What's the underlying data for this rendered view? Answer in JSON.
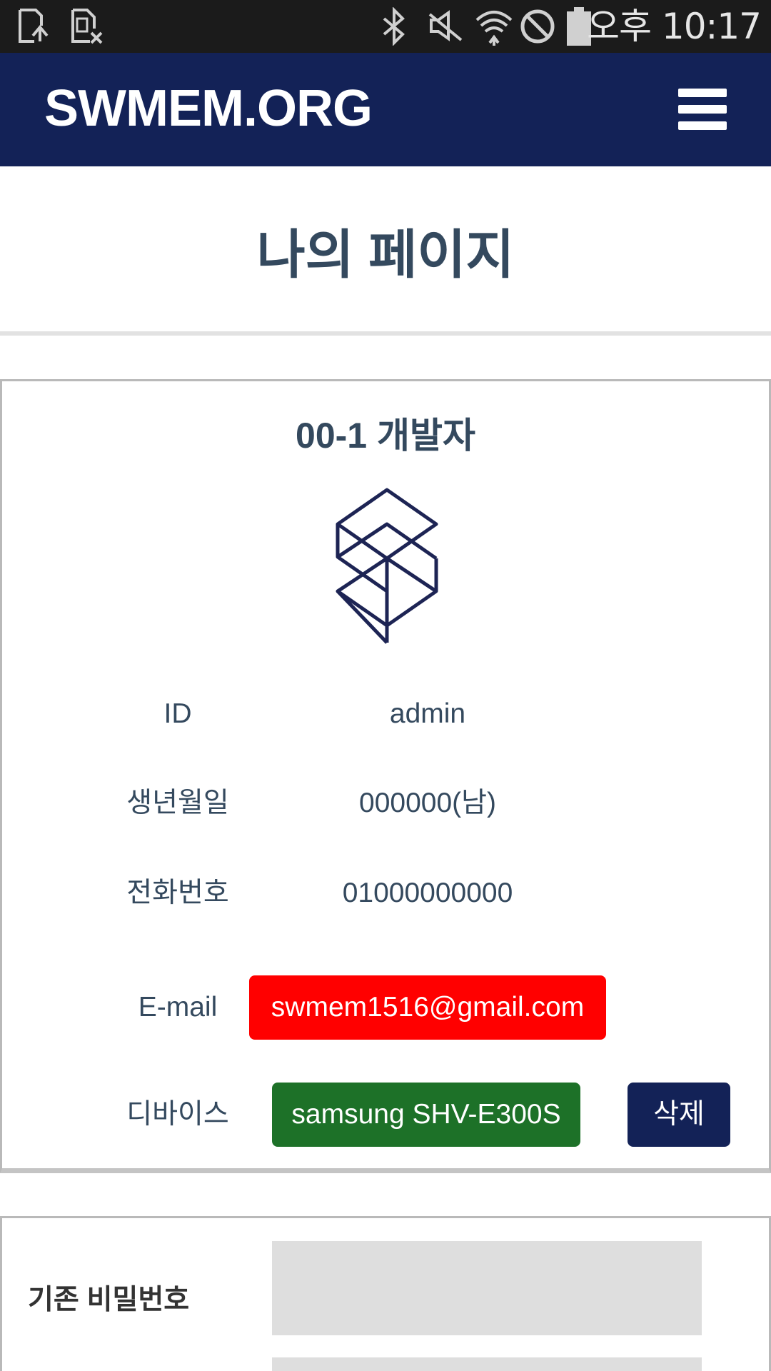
{
  "status_bar": {
    "time": "오후 10:17",
    "icons": [
      "screen-rotate-icon",
      "sim-card-off-icon",
      "bluetooth-icon",
      "mute-icon",
      "wifi-icon",
      "do-not-disturb-icon",
      "battery-icon"
    ]
  },
  "navbar": {
    "brand": "SWMEM.ORG",
    "menu_icon": "hamburger-menu-icon",
    "bg_color": "#132257"
  },
  "page": {
    "title": "나의 페이지"
  },
  "profile": {
    "name": "00-1 개발자",
    "rows": [
      {
        "label": "ID",
        "value": "admin"
      },
      {
        "label": "생년월일",
        "value": "000000(남)"
      },
      {
        "label": "전화번호",
        "value": "01000000000"
      },
      {
        "label": "E-mail",
        "value": "swmem1516@gmail.com"
      },
      {
        "label": "디바이스",
        "value": "samsung SHV-E300S"
      }
    ],
    "delete_label": "삭제",
    "colors": {
      "email_chip": "#ff0000",
      "device_chip": "#1d7128",
      "delete_button": "#132257"
    }
  },
  "password": {
    "current_label": "기존 비밀번호",
    "current_value": ""
  }
}
